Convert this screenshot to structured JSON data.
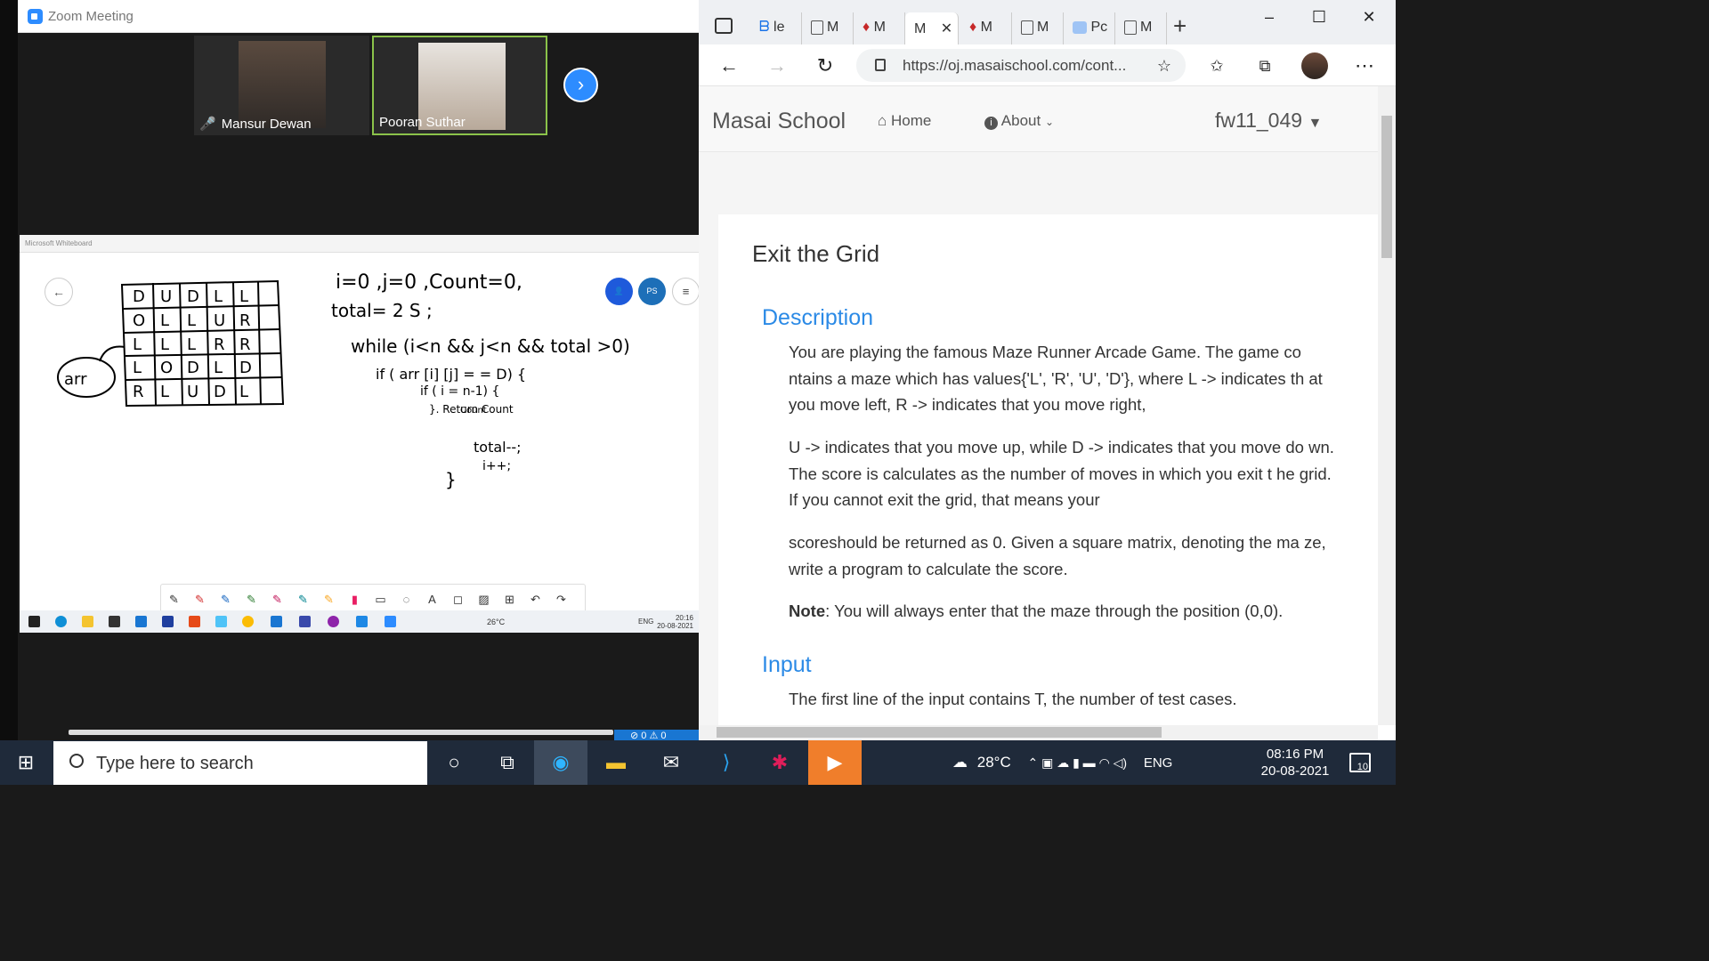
{
  "zoom": {
    "window_title": "Zoom Meeting",
    "participants": [
      {
        "name": "Mansur Dewan",
        "muted": true
      },
      {
        "name": "Pooran Suthar",
        "muted": false
      }
    ]
  },
  "whiteboard": {
    "window_title": "Microsoft Whiteboard",
    "avatar_1": "",
    "avatar_2": "PS",
    "grid": [
      [
        "D",
        "U",
        "D",
        "L",
        "L"
      ],
      [
        "O",
        "L",
        "L",
        "U",
        "R"
      ],
      [
        "L",
        "L",
        "L",
        "R",
        "R"
      ],
      [
        "L",
        "O",
        "D",
        "L",
        "D"
      ],
      [
        "R",
        "L",
        "U",
        "D",
        "L"
      ]
    ],
    "arr_label": "arr",
    "code_lines": [
      "i=0 ,j=0 ,Count=0,",
      "total= 2 S ;",
      "while (i<n && j<n && total >0)",
      "if ( arr [i] [j] = = D) {",
      "if ( i = n-1) {",
      "}.    Return Count",
      "Count",
      "total--;",
      "i++;",
      "}"
    ],
    "inner_tray": {
      "temp": "26°C",
      "lang": "ENG",
      "time": "20:16",
      "date": "20-08-2021"
    }
  },
  "browser": {
    "tabs": [
      "le",
      "M",
      "M",
      "M",
      "M",
      "M",
      "Pc",
      "M"
    ],
    "url": "https://oj.masaischool.com/cont...",
    "site": {
      "brand": "Masai School",
      "home": "Home",
      "about": "About",
      "user": "fw11_049"
    },
    "problem": {
      "title": "Exit the Grid",
      "description_heading": "Description",
      "para1": "You are playing the famous Maze Runner Arcade Game. The game co ntains a maze which has values{'L', 'R', 'U', 'D'}, where L -> indicates th at you move left, R -> indicates that you move right,",
      "para2": "U -> indicates that you move up, while D -> indicates that you move do wn. The score is calculates as the number of moves in which you exit t he grid. If you cannot exit the grid, that means your",
      "para3": "scoreshould be returned as 0. Given a square matrix, denoting the ma ze, write a program to calculate the score.",
      "note_label": "Note",
      "note_text": ": You will always enter that the maze through the position (0,0).",
      "input_heading": "Input",
      "input_text": "The first line of the input contains T, the number of test cases."
    }
  },
  "taskbar": {
    "search_placeholder": "Type here to search",
    "temperature": "28°C",
    "language": "ENG",
    "time": "08:16 PM",
    "date": "20-08-2021",
    "notifications": "10"
  },
  "zoom_status": "⊘ 0 ⚠ 0"
}
